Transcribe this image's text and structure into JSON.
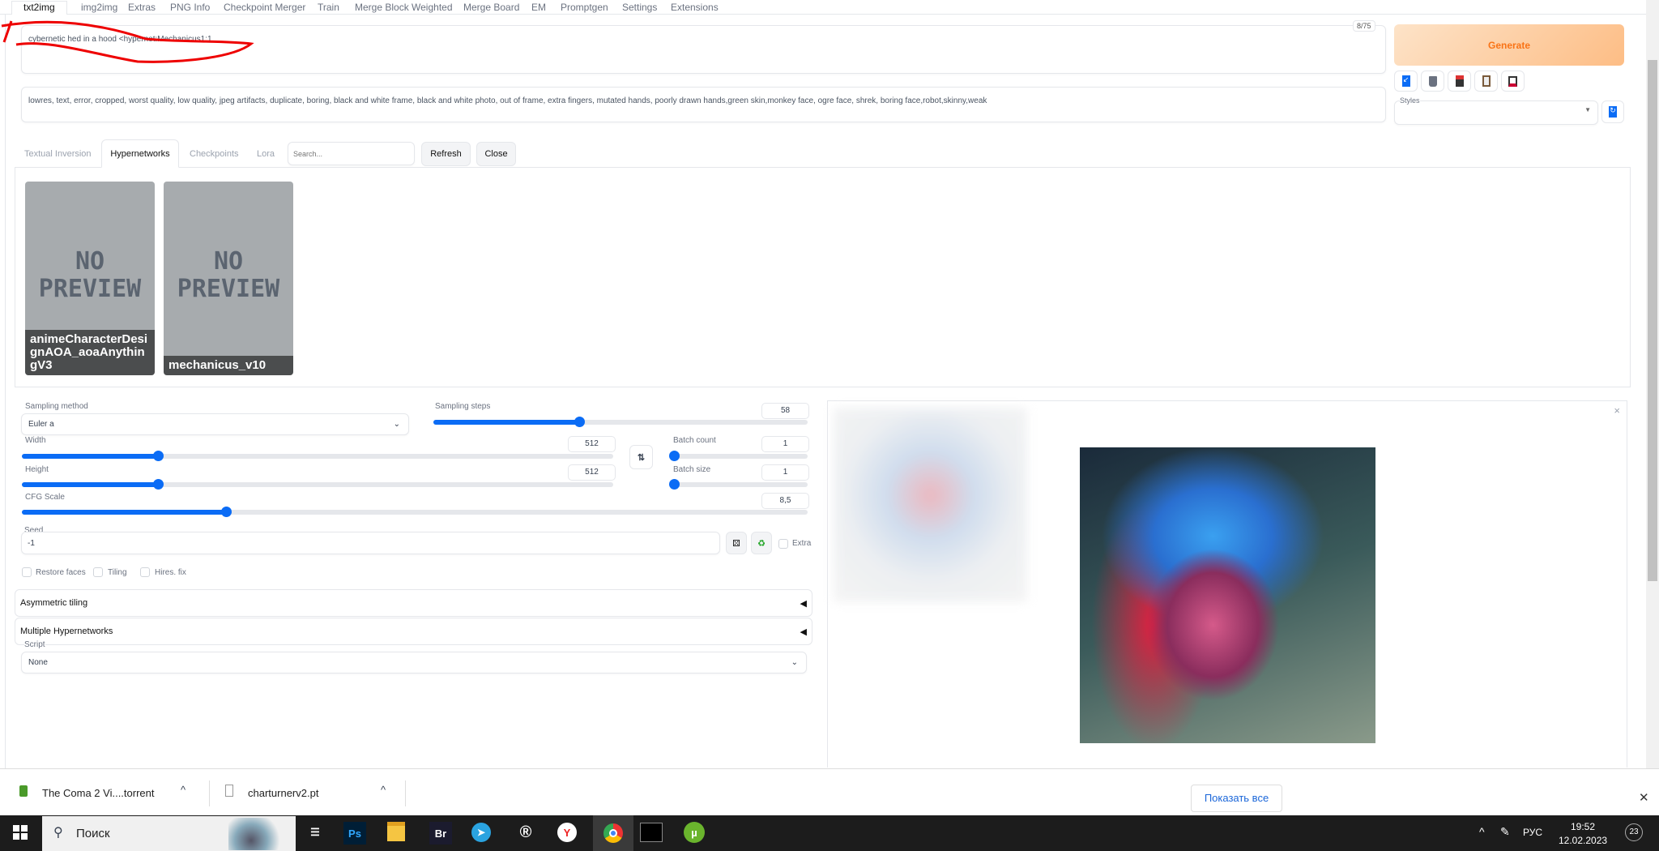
{
  "top_tabs": [
    "txt2img",
    "img2img",
    "Extras",
    "PNG Info",
    "Checkpoint Merger",
    "Train",
    "Merge Block Weighted",
    "Merge Board",
    "EM",
    "Promptgen",
    "Settings",
    "Extensions"
  ],
  "prompt": {
    "value": "cybernetic hed in a hood <hypernet:Mechanicus1:1",
    "token_count": "8/75"
  },
  "negative_prompt": {
    "value": "lowres, text, error, cropped, worst quality, low quality, jpeg artifacts, duplicate, boring, black and white frame, black and white photo, out of frame, extra fingers, mutated hands, poorly drawn hands,green skin,monkey face, ogre face, shrek, boring face,robot,skinny,weak"
  },
  "generate_label": "Generate",
  "styles": {
    "label": "Styles",
    "value": ""
  },
  "extra_networks": {
    "tabs": [
      "Textual Inversion",
      "Hypernetworks",
      "Checkpoints",
      "Lora"
    ],
    "active": "Hypernetworks",
    "search_placeholder": "Search...",
    "refresh": "Refresh",
    "close": "Close",
    "cards": [
      {
        "preview": "NO PREVIEW",
        "name": "animeCharacterDesignAOA_aoaAnythingV3"
      },
      {
        "preview": "NO PREVIEW",
        "name": "mechanicus_v10"
      }
    ]
  },
  "params": {
    "sampling_method": {
      "label": "Sampling method",
      "value": "Euler a"
    },
    "sampling_steps": {
      "label": "Sampling steps",
      "value": "58",
      "fraction": 0.39
    },
    "width": {
      "label": "Width",
      "value": "512",
      "fraction": 0.23
    },
    "height": {
      "label": "Height",
      "value": "512",
      "fraction": 0.23
    },
    "batch_count": {
      "label": "Batch count",
      "value": "1",
      "fraction": 0
    },
    "batch_size": {
      "label": "Batch size",
      "value": "1",
      "fraction": 0
    },
    "cfg_scale": {
      "label": "CFG Scale",
      "value": "8,5",
      "fraction": 0.26
    },
    "seed": {
      "label": "Seed",
      "value": "-1",
      "extra": "Extra"
    },
    "checkboxes": [
      "Restore faces",
      "Tiling",
      "Hires. fix"
    ],
    "accordions": [
      "Asymmetric tiling",
      "Multiple Hypernetworks"
    ],
    "script": {
      "label": "Script",
      "value": "None"
    }
  },
  "downloads": {
    "items": [
      "The Coma 2 Vi....torrent",
      "charturnerv2.pt"
    ],
    "show_all": "Показать все"
  },
  "taskbar": {
    "search": "Поиск",
    "lang": "РУС",
    "time": "19:52",
    "date": "12.02.2023",
    "notifications": "23",
    "apps": [
      "Ps",
      "Br"
    ]
  }
}
